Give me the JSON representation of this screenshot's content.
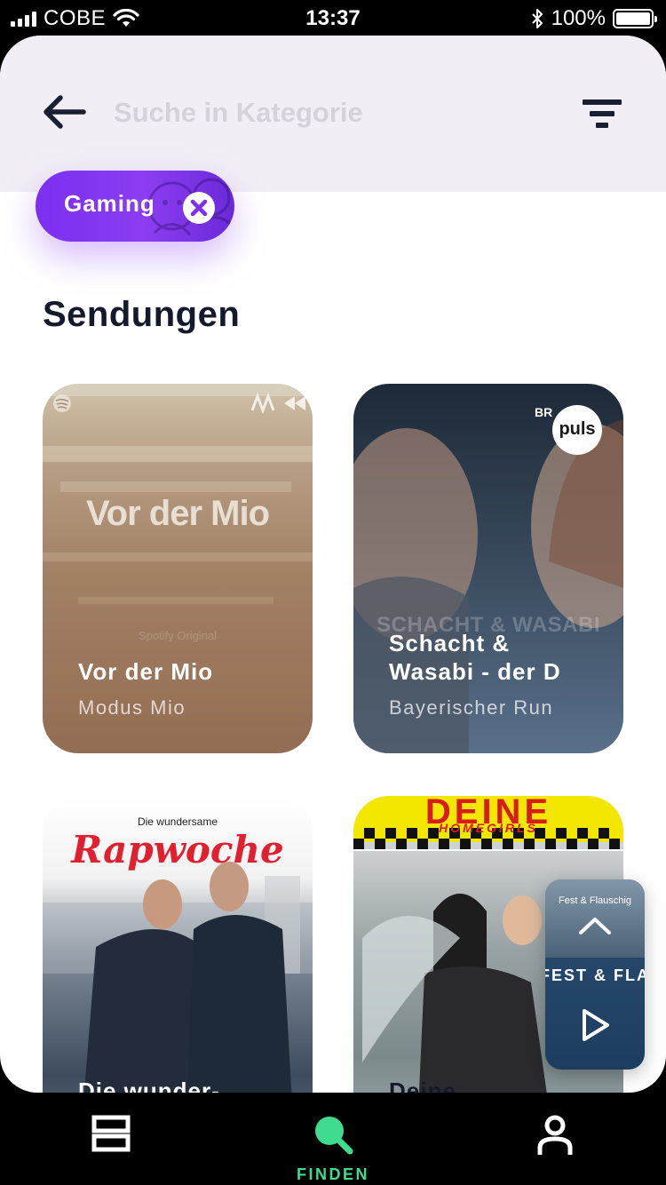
{
  "status_bar": {
    "carrier": "COBE",
    "time": "13:37",
    "battery": "100%"
  },
  "header": {
    "search_placeholder": "Suche in Kategorie",
    "back_icon": "arrow-left-icon",
    "filter_icon": "filter-icon"
  },
  "filter_chip": {
    "label": "Gaming",
    "close_icon": "close-icon"
  },
  "section": {
    "title": "Sendungen"
  },
  "cards": [
    {
      "cover_text": "Vor der Mio",
      "cover_caption": "Spotify Original",
      "title": "Vor der Mio",
      "subtitle": "Modus Mio"
    },
    {
      "cover_badge": "puls",
      "cover_brand": "BR",
      "cover_text": "SCHACHT & WASABI",
      "title": "Schacht &\nWasabi - der D",
      "subtitle": "Bayerischer Run"
    },
    {
      "cover_kicker": "Die wundersame",
      "cover_text": "Rapwoche",
      "title": "Die wunder-\nsame Rapwoch",
      "subtitle": ""
    },
    {
      "cover_text": "DEINE",
      "cover_text_2": "HOMEGIRLS",
      "title": "Deine\nHomegirls",
      "subtitle": ""
    }
  ],
  "mini_player": {
    "show_label": "Fest & Flauschig",
    "title": "FEST & FLA",
    "expand_icon": "chevron-up-icon",
    "play_icon": "play-icon"
  },
  "tab_bar": {
    "tabs": [
      {
        "icon": "library-icon",
        "label": ""
      },
      {
        "icon": "search-icon",
        "label": "FINDEN",
        "active": true
      },
      {
        "icon": "profile-icon",
        "label": ""
      }
    ],
    "active_color": "#3fdc8f"
  },
  "colors": {
    "chip_purple": "#7b2ff0",
    "header_bg": "#f2eef5",
    "text_dark": "#141a2b"
  }
}
